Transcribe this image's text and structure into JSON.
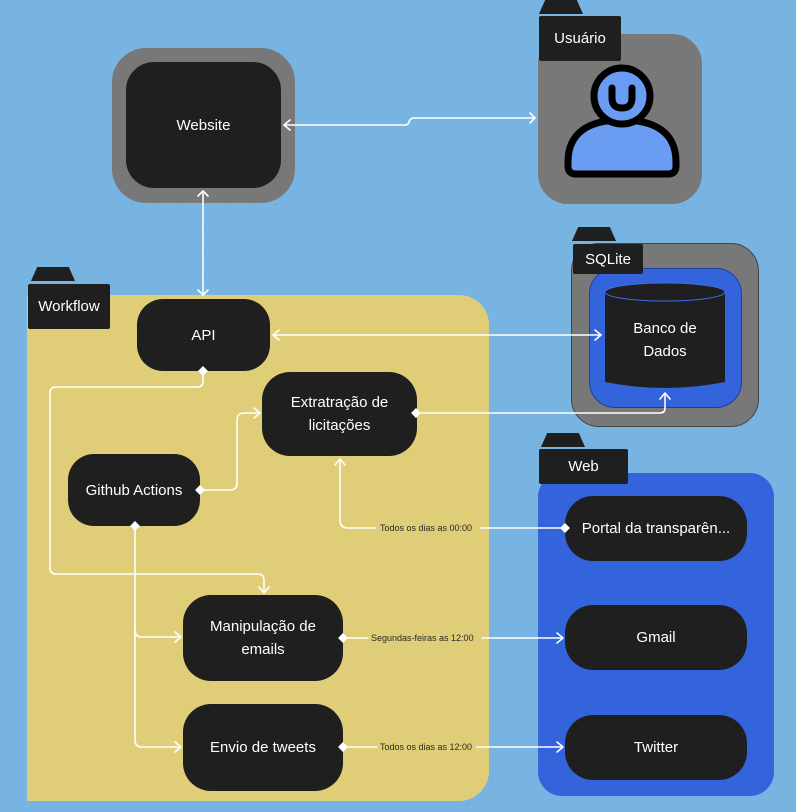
{
  "diagram": {
    "colors": {
      "background": "#78b4e1",
      "workflow_group": "#dfcd78",
      "web_group": "#3464dc",
      "gray_frame": "#787878",
      "node": "#1f1f1f",
      "user_icon_fill": "#6a9cf2",
      "connector": "#ffffff"
    },
    "groups": {
      "usuario": {
        "label": "Usuário"
      },
      "sqlite": {
        "label": "SQLite"
      },
      "workflow": {
        "label": "Workflow"
      },
      "web": {
        "label": "Web"
      }
    },
    "nodes": {
      "website": "Website",
      "user_icon": "user-icon",
      "api": "API",
      "database": "Banco de Dados",
      "extraction": "Extratração de licitações",
      "github_actions": "Github Actions",
      "emails": "Manipulação de emails",
      "tweets": "Envio de tweets",
      "portal": "Portal da transparên...",
      "gmail": "Gmail",
      "twitter": "Twitter"
    },
    "edges": [
      {
        "from": "website",
        "to": "usuario",
        "type": "bidirectional",
        "label": ""
      },
      {
        "from": "website",
        "to": "api",
        "type": "bidirectional",
        "label": ""
      },
      {
        "from": "api",
        "to": "database",
        "type": "bidirectional",
        "label": ""
      },
      {
        "from": "extraction",
        "to": "database",
        "type": "directed",
        "label": ""
      },
      {
        "from": "github_actions",
        "to": "extraction",
        "type": "directed",
        "label": ""
      },
      {
        "from": "api",
        "to": "emails",
        "type": "directed",
        "label": ""
      },
      {
        "from": "github_actions",
        "to": "emails",
        "type": "directed",
        "label": ""
      },
      {
        "from": "github_actions",
        "to": "tweets",
        "type": "directed",
        "label": ""
      },
      {
        "from": "portal",
        "to": "extraction",
        "type": "directed",
        "label": "Todos os dias as 00:00"
      },
      {
        "from": "emails",
        "to": "gmail",
        "type": "directed",
        "label": "Segundas-feiras as 12:00"
      },
      {
        "from": "tweets",
        "to": "twitter",
        "type": "directed",
        "label": "Todos os dias as 12:00"
      }
    ]
  }
}
